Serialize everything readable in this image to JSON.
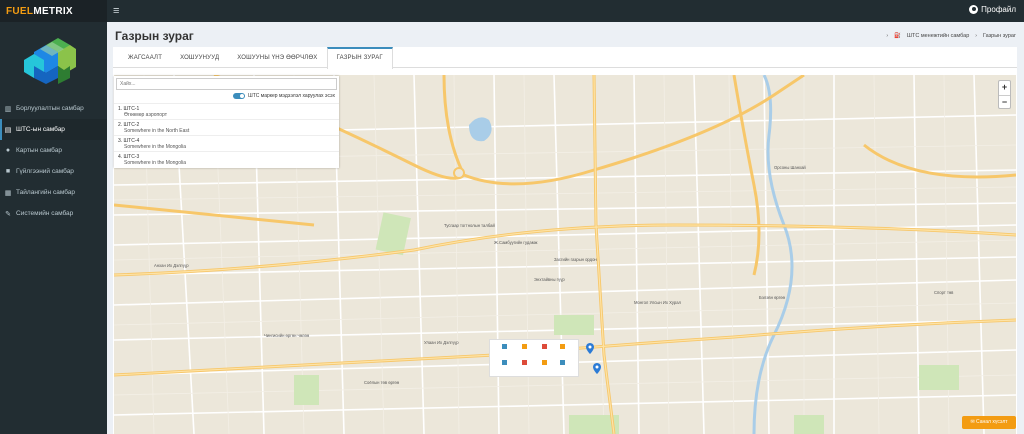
{
  "brand": {
    "part1": "FUEL",
    "part2": "METRIX"
  },
  "header": {
    "menu_icon": "bars-icon",
    "profile_label": "Профайл",
    "profile_icon": "user-circle-icon"
  },
  "sidebar": {
    "items": [
      {
        "label": "Борлуулалтын самбар",
        "icon": "line-chart-icon"
      },
      {
        "label": "ШТС-ын самбар",
        "icon": "id-card-icon",
        "active": true
      },
      {
        "label": "Картын самбар",
        "icon": "users-icon"
      },
      {
        "label": "Гүйлгээний самбар",
        "icon": "truck-icon"
      },
      {
        "label": "Тайлангийн самбар",
        "icon": "table-icon"
      },
      {
        "label": "Системийн самбар",
        "icon": "wrench-icon"
      }
    ]
  },
  "page": {
    "title": "Газрын зураг",
    "breadcrumb": [
      "ШТС менежтийн самбар",
      "Газрын зураг"
    ]
  },
  "tabs": [
    {
      "label": "ЖАГСААЛТ"
    },
    {
      "label": "ХОШУУНУУД"
    },
    {
      "label": "ХОШУУНЫ ҮНЭ ӨӨРЧЛӨХ"
    },
    {
      "label": "ГАЗРЫН ЗУРАГ",
      "active": true
    }
  ],
  "search": {
    "placeholder": "Хайх..."
  },
  "toggle": {
    "label": "ШТС маркер мэдээлэл харуулах эсэх",
    "on": true
  },
  "stations": [
    {
      "name": "1. ШТС-1",
      "location": "Өгөөмөр аэропорт"
    },
    {
      "name": "2. ШТС-2",
      "location": "Somewhere in the North East"
    },
    {
      "name": "3. ШТС-4",
      "location": "Somewhere in the Mongolia"
    },
    {
      "name": "4. ШТС-3",
      "location": "Somewhere in the Mongolia"
    }
  ],
  "zoom": {
    "in": "+",
    "out": "−"
  },
  "feedback": {
    "label": "Санал хүсэлт",
    "icon": "comments-icon"
  },
  "map_labels": [
    "Чингисийн өргөн чөлөө",
    "Энхтайваны өргөн чөлөө",
    "Бага тойруу",
    "Улаан Их Дэлгүүр",
    "Энхтайвны гүүр",
    "Сүхбаатарын талбай",
    "Тусгаар тогтнолын талбай",
    "Засгийн газрын ордон",
    "Ж.Самбуугийн гудамж",
    "Бэлэвн өргөө",
    "Орсоны Шанхай",
    "Монгол Улсын Их Хурал",
    "Ардын Дуурийн театр",
    "Соёлын төв өргөө",
    "Спорт төв",
    "Анхан Их Дэлгүүр"
  ]
}
